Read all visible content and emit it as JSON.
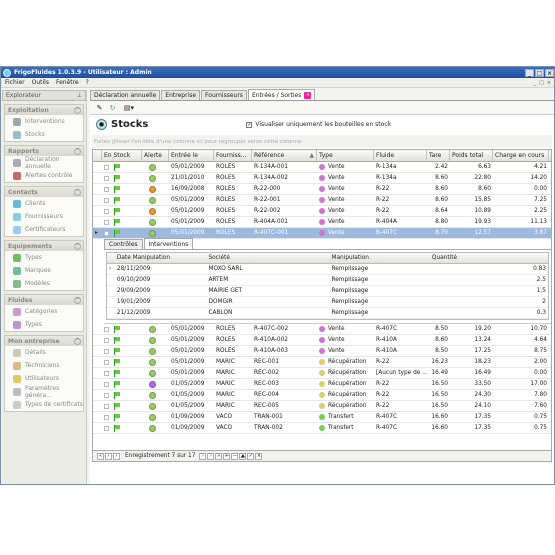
{
  "window": {
    "title": "FrigoFluides 1.0.3.9 - Utilisateur : Admin"
  },
  "menu": [
    "Fichier",
    "Outils",
    "Fenêtre",
    "?"
  ],
  "sidebar": {
    "explorer": "Explorateur",
    "groups": [
      {
        "title": "Exploitation",
        "items": [
          {
            "label": "Interventions",
            "icon": "wrench-icon",
            "color": "#9aa"
          },
          {
            "label": "Stocks",
            "icon": "cylinder-icon",
            "color": "#9bc"
          }
        ]
      },
      {
        "title": "Rapports",
        "items": [
          {
            "label": "Déclaration annuelle",
            "icon": "report-icon",
            "color": "#aab"
          },
          {
            "label": "Alertes contrôle",
            "icon": "alert-icon",
            "color": "#c66"
          }
        ]
      },
      {
        "title": "Contacts",
        "items": [
          {
            "label": "Clients",
            "icon": "clients-icon",
            "color": "#6bd"
          },
          {
            "label": "Fournisseurs",
            "icon": "suppliers-icon",
            "color": "#8cd"
          },
          {
            "label": "Certificateurs",
            "icon": "certifiers-icon",
            "color": "#9ce"
          }
        ]
      },
      {
        "title": "Equipements",
        "items": [
          {
            "label": "Types",
            "icon": "cube-icon",
            "color": "#7b6"
          },
          {
            "label": "Marques",
            "icon": "brand-icon",
            "color": "#7b9"
          },
          {
            "label": "Modèles",
            "icon": "model-icon",
            "color": "#8b8"
          }
        ]
      },
      {
        "title": "Fluides",
        "items": [
          {
            "label": "Catégories",
            "icon": "categories-icon",
            "color": "#c9c"
          },
          {
            "label": "Types",
            "icon": "fluid-types-icon",
            "color": "#b9c"
          }
        ]
      },
      {
        "title": "Mon entreprise",
        "items": [
          {
            "label": "Détails",
            "icon": "details-icon",
            "color": "#ccb"
          },
          {
            "label": "Techniciens",
            "icon": "technician-icon",
            "color": "#db8"
          },
          {
            "label": "Utilisateurs",
            "icon": "users-icon",
            "color": "#dc6"
          },
          {
            "label": "Paramètres généra...",
            "icon": "settings-icon",
            "color": "#bbb"
          },
          {
            "label": "Types de certificats",
            "icon": "certificate-types-icon",
            "color": "#ccc"
          }
        ]
      }
    ]
  },
  "tabs": [
    {
      "label": "Déclaration annuelle"
    },
    {
      "label": "Entreprise"
    },
    {
      "label": "Fournisseurs"
    },
    {
      "label": "Entrées / Sorties"
    }
  ],
  "panel": {
    "title": "Stocks",
    "checkbox_label": "Visualiser uniquement les bouteilles en stock",
    "group_hint": "Faites glisser l'en-tête d'une colonne ici pour regrouper selon cette colonne"
  },
  "grid": {
    "columns": [
      "En Stock",
      "Alerte",
      "Entrée le",
      "Fourniss...",
      "Référence",
      "Type",
      "Fluide",
      "Tare",
      "Poids total",
      "Charge en cours"
    ],
    "rows": [
      {
        "alert": "#9c6",
        "date": "05/01/2009",
        "four": "ROLES",
        "ref": "R-134A-001",
        "type": "Vente",
        "tcol": "#c7c",
        "fluide": "R-134a",
        "tare": "2.42",
        "poids": "6.63",
        "charge": "4.21"
      },
      {
        "alert": "#9c6",
        "date": "21/01/2010",
        "four": "ROLES",
        "ref": "R-134A-002",
        "type": "Vente",
        "tcol": "#c7c",
        "fluide": "R-134a",
        "tare": "8.60",
        "poids": "22.80",
        "charge": "14.20"
      },
      {
        "alert": "#e93",
        "date": "16/09/2008",
        "four": "ROLES",
        "ref": "R-22-000",
        "type": "Vente",
        "tcol": "#c7c",
        "fluide": "R-22",
        "tare": "8.60",
        "poids": "8.60",
        "charge": "0.00"
      },
      {
        "alert": "#9c6",
        "date": "05/01/2009",
        "four": "ROLES",
        "ref": "R-22-001",
        "type": "Vente",
        "tcol": "#c7c",
        "fluide": "R-22",
        "tare": "8.60",
        "poids": "15.85",
        "charge": "7.25"
      },
      {
        "alert": "#e93",
        "date": "05/01/2009",
        "four": "ROLES",
        "ref": "R-22-002",
        "type": "Vente",
        "tcol": "#c7c",
        "fluide": "R-22",
        "tare": "8.64",
        "poids": "10.89",
        "charge": "2.25"
      },
      {
        "alert": "#9c6",
        "date": "05/01/2009",
        "four": "ROLES",
        "ref": "R-404A-001",
        "type": "Vente",
        "tcol": "#c7c",
        "fluide": "R-404A",
        "tare": "8.80",
        "poids": "19.93",
        "charge": "11.13"
      },
      {
        "alert": "#9c6",
        "date": "05/01/2009",
        "four": "ROLES",
        "ref": "R-407C-001",
        "type": "Vente",
        "tcol": "#c7c",
        "fluide": "R-407C",
        "tare": "8.70",
        "poids": "12.57",
        "charge": "3.87",
        "selected": true
      }
    ],
    "rows2": [
      {
        "alert": "#9c6",
        "date": "05/01/2009",
        "four": "ROLES",
        "ref": "R-407C-002",
        "type": "Vente",
        "tcol": "#c7c",
        "fluide": "R-407C",
        "tare": "8.50",
        "poids": "19.20",
        "charge": "10.70"
      },
      {
        "alert": "#9c6",
        "date": "05/01/2009",
        "four": "ROLES",
        "ref": "R-410A-002",
        "type": "Vente",
        "tcol": "#c7c",
        "fluide": "R-410A",
        "tare": "8.60",
        "poids": "13.24",
        "charge": "4.64"
      },
      {
        "alert": "#9c6",
        "date": "05/01/2009",
        "four": "ROLES",
        "ref": "R-410A-003",
        "type": "Vente",
        "tcol": "#c7c",
        "fluide": "R-410A",
        "tare": "8.50",
        "poids": "17.25",
        "charge": "8.75"
      },
      {
        "alert": "#9c6",
        "date": "05/01/2009",
        "four": "MARIC",
        "ref": "REC-001",
        "type": "Récupération",
        "tcol": "#dc7",
        "fluide": "R-22",
        "tare": "16.23",
        "poids": "18.23",
        "charge": "2.00"
      },
      {
        "alert": "#9c6",
        "date": "05/01/2009",
        "four": "MARIC",
        "ref": "REC-002",
        "type": "Récupération",
        "tcol": "#dc7",
        "fluide": "[Aucun type de ...",
        "tare": "16.49",
        "poids": "16.49",
        "charge": "0.00"
      },
      {
        "alert": "#b6e",
        "date": "01/05/2009",
        "four": "MARIC",
        "ref": "REC-003",
        "type": "Récupération",
        "tcol": "#dc7",
        "fluide": "R-22",
        "tare": "16.50",
        "poids": "33.50",
        "charge": "17.00"
      },
      {
        "alert": "#9c6",
        "date": "01/05/2009",
        "four": "MARIC",
        "ref": "REC-004",
        "type": "Récupération",
        "tcol": "#dc7",
        "fluide": "R-22",
        "tare": "16.50",
        "poids": "24.30",
        "charge": "7.80"
      },
      {
        "alert": "#9c6",
        "date": "01/05/2009",
        "four": "MARIC",
        "ref": "REC-005",
        "type": "Récupération",
        "tcol": "#dc7",
        "fluide": "R-22",
        "tare": "16.50",
        "poids": "24.10",
        "charge": "7.60"
      },
      {
        "alert": "#9c6",
        "date": "01/09/2009",
        "four": "VACO",
        "ref": "TRAN-001",
        "type": "Transfert",
        "tcol": "#7c5",
        "fluide": "R-407C",
        "tare": "16.60",
        "poids": "17.35",
        "charge": "0.75"
      },
      {
        "alert": "#9c6",
        "date": "01/09/2009",
        "four": "VACO",
        "ref": "TRAN-002",
        "type": "Transfert",
        "tcol": "#7c5",
        "fluide": "R-407C",
        "tare": "16.60",
        "poids": "17.35",
        "charge": "0.75"
      }
    ]
  },
  "detail": {
    "tabs": [
      "Contrôles",
      "Interventions"
    ],
    "columns": [
      "Date Manipulation",
      "Société",
      "Manipulation",
      "Quantité"
    ],
    "rows": [
      {
        "date": "28/11/2009",
        "societe": "MOXO SARL",
        "manip": "Remplissage",
        "qte": "0.83"
      },
      {
        "date": "09/10/2009",
        "societe": "ARTEM",
        "manip": "Remplissage",
        "qte": "2.5"
      },
      {
        "date": "29/09/2009",
        "societe": "MAIRIE GET",
        "manip": "Remplissage",
        "qte": "1.5"
      },
      {
        "date": "19/01/2009",
        "societe": "DOMGIR",
        "manip": "Remplissage",
        "qte": "2"
      },
      {
        "date": "21/12/2009",
        "societe": "CABLON",
        "manip": "Remplissage",
        "qte": "0.3"
      }
    ]
  },
  "nav": {
    "record": "Enregistrement 7 sur 17"
  }
}
